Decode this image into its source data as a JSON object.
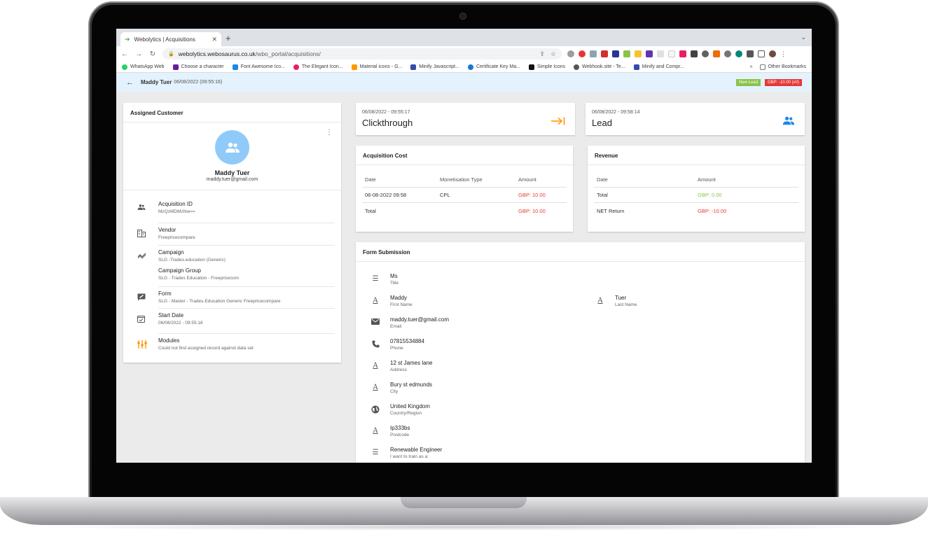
{
  "browser": {
    "tab_title": "Webolytics | Acquisitions",
    "url_host": "webolytics.webosaurus.co.uk",
    "url_path": "/wbo_portal/acquisitions/",
    "bookmarks": [
      {
        "label": "WhatsApp Web",
        "color": "#25d366"
      },
      {
        "label": "Choose a character",
        "color": "#6a1b9a"
      },
      {
        "label": "Font Awesome Ico...",
        "color": "#1e88e5"
      },
      {
        "label": "The Elegant Icon...",
        "color": "#e91e63"
      },
      {
        "label": "Material icons - G...",
        "color": "#ff9800"
      },
      {
        "label": "Minify Javascript...",
        "color": "#3949ab"
      },
      {
        "label": "Certificate Key Ma...",
        "color": "#1976d2"
      },
      {
        "label": "Simple Icons",
        "color": "#111111"
      },
      {
        "label": "Webhook.site - Te...",
        "color": "#555555"
      },
      {
        "label": "Minify and Compr...",
        "color": "#3949ab"
      }
    ],
    "bookmarks_overflow": "»",
    "other_bookmarks": "Other Bookmarks"
  },
  "header": {
    "name": "Maddy Tuer",
    "date": "06/08/2022 (09:55:16)",
    "badge_lead": "New Lead",
    "badge_gbp": "GBP: -10.00 (x0)"
  },
  "customer": {
    "title": "Assigned Customer",
    "name": "Maddy Tuer",
    "email": "maddy.tuer@gmail.com",
    "rows": {
      "acquisition_label": "Acquisition ID",
      "acquisition_value": "MzQzMDMzNw==",
      "vendor_label": "Vendor",
      "vendor_value": "Freepricecompare",
      "campaign_label": "Campaign",
      "campaign_value": "SLG -Trades.education (Generic)",
      "campaign_group_label": "Campaign Group",
      "campaign_group_value": "SLG - Trades Education - Freepricecom",
      "form_label": "Form",
      "form_value": "SLG - Master - Trades-Education Generic Freepricecompare",
      "start_label": "Start Date",
      "start_value": "06/08/2022 - 09:55:16",
      "modules_label": "Modules",
      "modules_value": "Could not find assigned record against data set"
    }
  },
  "events": [
    {
      "date": "06/08/2022 - 09:55:17",
      "title": "Clickthrough",
      "icon": "arrow-to-end-icon",
      "color": "#ff9800"
    },
    {
      "date": "06/08/2022 - 09:58:14",
      "title": "Lead",
      "icon": "people-icon",
      "color": "#1e88e5"
    }
  ],
  "cost": {
    "title": "Acquisition Cost",
    "headers": [
      "Date",
      "Monetisation Type",
      "Amount"
    ],
    "row": {
      "date": "06-08-2022 09:58",
      "type": "CPL",
      "amount": "GBP: 10.00"
    },
    "total_label": "Total",
    "total_amount": "GBP: 10.00"
  },
  "revenue": {
    "title": "Revenue",
    "headers": [
      "Date",
      "Amount"
    ],
    "total_label": "Total",
    "total_amount": "GBP: 0.00",
    "net_label": "NET Return",
    "net_amount": "GBP: -10.00"
  },
  "form": {
    "title": "Form Submission",
    "fields": [
      {
        "value": "Ms",
        "label": "Title",
        "icon": "list-icon"
      },
      {
        "value": "Maddy",
        "label": "First Name",
        "icon": "text-icon"
      },
      {
        "value": "Tuer",
        "label": "Last Name",
        "icon": "text-icon"
      },
      {
        "value": "maddy.tuer@gmail.com",
        "label": "Email",
        "icon": "mail-icon"
      },
      {
        "value": "07815534884",
        "label": "Phone",
        "icon": "phone-icon"
      },
      {
        "value": "12 st James lane",
        "label": "Address",
        "icon": "text-icon"
      },
      {
        "value": "Bury st edmunds",
        "label": "City",
        "icon": "text-icon"
      },
      {
        "value": "United Kingdom",
        "label": "Country/Region",
        "icon": "globe-icon"
      },
      {
        "value": "Ip333bs",
        "label": "Postcode",
        "icon": "text-icon"
      },
      {
        "value": "Renewable Engineer",
        "label": "I want to train as a:",
        "icon": "list-icon"
      }
    ]
  }
}
